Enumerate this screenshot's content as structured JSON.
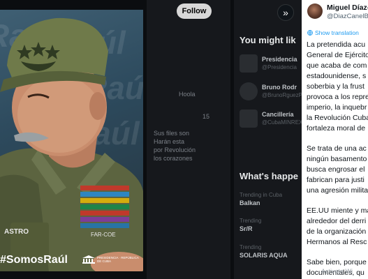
{
  "background": {
    "follow_label": "Follow",
    "you_might_like": "You might lik",
    "suggestions": [
      {
        "name": "Presidencia",
        "handle": "@Presidencia"
      },
      {
        "name": "Bruno Rodr",
        "handle": "@BrunoRguezP"
      },
      {
        "name": "Cancillería",
        "handle": "@CubaMINREX"
      }
    ],
    "whats_happening": "What's happe",
    "trends": [
      {
        "context": "Trending in Cuba",
        "label": "Balkan"
      },
      {
        "context": "Trending",
        "label": "Sr/R"
      },
      {
        "context": "Trending",
        "label": "SOLARIS AQUA"
      }
    ],
    "body_lines": [
      "Sus files son",
      "Harán esta",
      "por Revolución",
      "los corazones"
    ],
    "meta_text": "Hoola",
    "count_text": "15"
  },
  "photo": {
    "watermarks": [
      "Raúl",
      "Raúl",
      "Raúl",
      "Raúl"
    ],
    "hashtag": "#SomosRaúl",
    "name_tag": "ASTRO",
    "tag_left": "FAR-COE",
    "footer_seal": "PRESIDENCIA · REPÚBLICA DE CUBA"
  },
  "media_nav": {
    "next_icon": "»"
  },
  "tweet": {
    "author_name": "Miguel Díaz-C",
    "author_handle": "@DiazCanelB",
    "translate_label": "Show translation",
    "paragraphs": [
      [
        "La pretendida acu",
        "General de Ejército",
        "que acaba de com",
        "estadounidense, s",
        "soberbia y la frust",
        "provoca a los repre",
        "imperio, la inquebr",
        "la Revolución Cuba",
        "fortaleza moral de"
      ],
      [
        "Se trata de una ac",
        "ningún basamento",
        "busca engrosar el",
        "fabrican para justi",
        "una agresión milita"
      ],
      [
        "EE.UU miente y ma",
        "alrededor del derri",
        "de la organización",
        "Hermanos al Resc"
      ],
      [
        "Sabe bien, porque",
        "documentales, qu"
      ]
    ],
    "activate_text": "Activate Wi"
  }
}
